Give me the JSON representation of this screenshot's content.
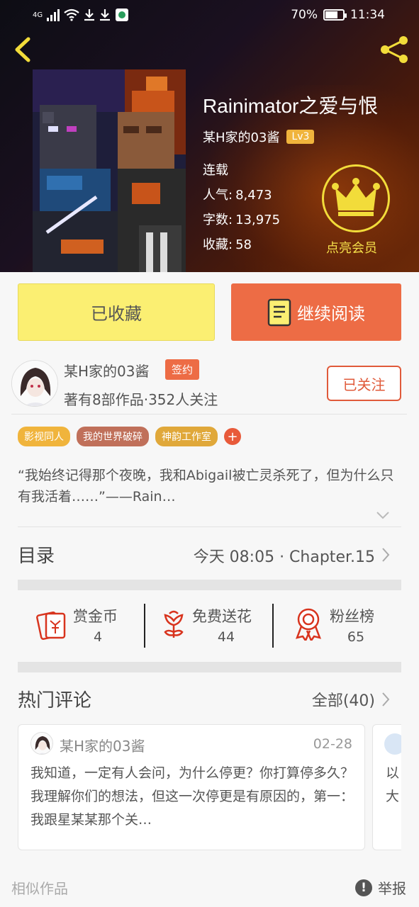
{
  "status_bar": {
    "network": "4G",
    "battery": "70%",
    "battery_level": 0.7,
    "time": "11:34"
  },
  "book": {
    "title": "Rainimator之爱与恨",
    "author": "某H家的03酱",
    "level": "Lv3",
    "status": "连载",
    "popularity_label": "人气:",
    "popularity": "8,473",
    "words_label": "字数:",
    "words": "13,975",
    "favorites_label": "收藏:",
    "favorites": "58",
    "vip_label": "点亮会员"
  },
  "actions": {
    "favorited_label": "已收藏",
    "continue_label": "继续阅读"
  },
  "author_card": {
    "name": "某H家的03酱",
    "sign_badge": "签约",
    "stats": "著有8部作品·352人关注",
    "follow_label": "已关注"
  },
  "tags": [
    {
      "label": "影视同人",
      "color": "#f0b43c"
    },
    {
      "label": "我的世界破碎",
      "color": "#c0705a"
    },
    {
      "label": "神韵工作室",
      "color": "#e0a83a"
    }
  ],
  "tag_more": "+",
  "synopsis": "“我始终记得那个夜晚，我和Abigail被亡灵杀死了，但为什么只有我活着……”——Rain…",
  "catalog": {
    "title": "目录",
    "latest": "今天 08:05 · Chapter.15"
  },
  "stats": [
    {
      "label": "赏金币",
      "value": "4",
      "icon": "red-envelope-icon"
    },
    {
      "label": "免费送花",
      "value": "44",
      "icon": "flower-icon"
    },
    {
      "label": "粉丝榜",
      "value": "65",
      "icon": "medal-icon"
    }
  ],
  "comments": {
    "title": "热门评论",
    "all_label": "全部(40)",
    "items": [
      {
        "user": "某H家的03酱",
        "date": "02-28",
        "text": "我知道，一定有人会问，为什么停更？你打算停多久？我理解你们的想法，但这一次停更是有原因的，第一：我跟星某某那个关…"
      }
    ],
    "peek_line1": "以",
    "peek_line2": "大"
  },
  "footer": {
    "similar_label": "相似作品",
    "report_label": "举报",
    "report_icon_glyph": "!"
  },
  "colors": {
    "accent_orange": "#ed6c45",
    "fav_yellow": "#fbef72",
    "crown_yellow": "#f2dc3a"
  }
}
